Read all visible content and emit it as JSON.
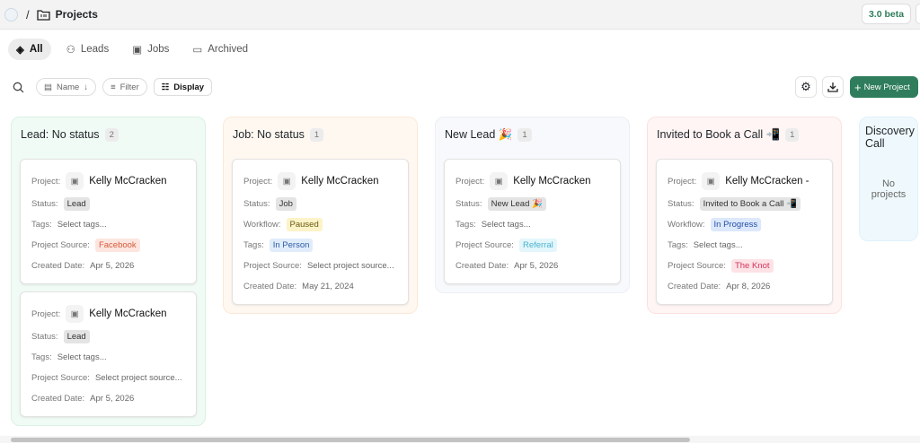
{
  "header": {
    "separator": "/",
    "title": "Projects",
    "beta": "3.0 beta"
  },
  "tabs": [
    {
      "label": "All",
      "icon": "layers-icon"
    },
    {
      "label": "Leads",
      "icon": "user-plus-icon"
    },
    {
      "label": "Jobs",
      "icon": "folder-icon"
    },
    {
      "label": "Archived",
      "icon": "archive-icon"
    }
  ],
  "toolbar": {
    "sort": "Name",
    "filter": "Filter",
    "display": "Display",
    "new_project": "New Project"
  },
  "columns": [
    {
      "title": "Lead: No status",
      "count": "2",
      "bg": "#f1fbf5",
      "border": "#d8f1e2",
      "cards": [
        {
          "name": "Kelly McCracken",
          "fields": [
            {
              "label": "Status:",
              "value": "Lead",
              "style": "b-gray"
            },
            {
              "label": "Tags:",
              "value": "Select tags...",
              "style": ""
            },
            {
              "label": "Project Source:",
              "value": "Facebook",
              "style": "b-orange"
            },
            {
              "label": "Created Date:",
              "value": "Apr 5, 2026",
              "style": ""
            }
          ]
        },
        {
          "name": "Kelly McCracken",
          "fields": [
            {
              "label": "Status:",
              "value": "Lead",
              "style": "b-gray"
            },
            {
              "label": "Tags:",
              "value": "Select tags...",
              "style": ""
            },
            {
              "label": "Project Source:",
              "value": "Select project source...",
              "style": ""
            },
            {
              "label": "Created Date:",
              "value": "Apr 5, 2026",
              "style": ""
            }
          ]
        }
      ]
    },
    {
      "title": "Job: No status",
      "count": "1",
      "bg": "#fff8f1",
      "border": "#fbe9d8",
      "cards": [
        {
          "name": "Kelly McCracken",
          "fields": [
            {
              "label": "Status:",
              "value": "Job",
              "style": "b-gray"
            },
            {
              "label": "Workflow:",
              "value": "Paused",
              "style": "b-yellow"
            },
            {
              "label": "Tags:",
              "value": "In Person",
              "style": "b-lblue"
            },
            {
              "label": "Project Source:",
              "value": "Select project source...",
              "style": ""
            },
            {
              "label": "Created Date:",
              "value": "May 21, 2024",
              "style": ""
            }
          ]
        }
      ]
    },
    {
      "title": "New Lead 🎉",
      "count": "1",
      "bg": "#f7f9fc",
      "border": "#eceff4",
      "cards": [
        {
          "name": "Kelly McCracken",
          "fields": [
            {
              "label": "Status:",
              "value": "New Lead 🎉",
              "style": "b-gray"
            },
            {
              "label": "Tags:",
              "value": "Select tags...",
              "style": ""
            },
            {
              "label": "Project Source:",
              "value": "Referral",
              "style": "b-cyan"
            },
            {
              "label": "Created Date:",
              "value": "Apr 5, 2026",
              "style": ""
            }
          ]
        }
      ]
    },
    {
      "title": "Invited to Book a Call 📲",
      "count": "1",
      "bg": "#fff5f5",
      "border": "#fbe1e1",
      "cards": [
        {
          "name": "Kelly McCracken -",
          "fields": [
            {
              "label": "Status:",
              "value": "Invited to Book a Call 📲",
              "style": "b-gray"
            },
            {
              "label": "Workflow:",
              "value": "In Progress",
              "style": "b-blue"
            },
            {
              "label": "Tags:",
              "value": "Select tags...",
              "style": ""
            },
            {
              "label": "Project Source:",
              "value": "The Knot",
              "style": "b-pink"
            },
            {
              "label": "Created Date:",
              "value": "Apr 8, 2026",
              "style": ""
            }
          ]
        }
      ]
    },
    {
      "title": "Discovery Call",
      "count": "",
      "bg": "#eff9fd",
      "border": "#dff1f9",
      "empty": "No projects",
      "cards": []
    }
  ]
}
